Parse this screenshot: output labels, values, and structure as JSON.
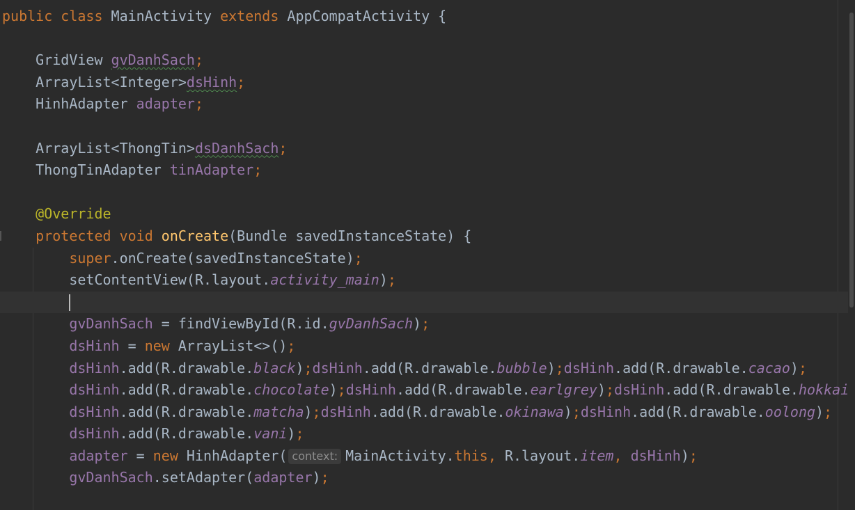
{
  "editor": {
    "current_line_index": 13,
    "lines": [
      {
        "tokens": [
          {
            "t": "public ",
            "c": "keyword"
          },
          {
            "t": "class ",
            "c": "keyword"
          },
          {
            "t": "MainActivity ",
            "c": "ident"
          },
          {
            "t": "extends ",
            "c": "keyword"
          },
          {
            "t": "AppCompatActivity {",
            "c": "ident"
          }
        ]
      },
      {
        "tokens": []
      },
      {
        "tokens": [
          {
            "t": "    GridView ",
            "c": "ident"
          },
          {
            "t": "gvDanhSach",
            "c": "field",
            "warn": true
          },
          {
            "t": ";",
            "c": "punct"
          }
        ]
      },
      {
        "tokens": [
          {
            "t": "    ArrayList<Integer>",
            "c": "ident"
          },
          {
            "t": "dsHinh",
            "c": "field",
            "warn": true
          },
          {
            "t": ";",
            "c": "punct"
          }
        ]
      },
      {
        "tokens": [
          {
            "t": "    HinhAdapter ",
            "c": "ident"
          },
          {
            "t": "adapter",
            "c": "field"
          },
          {
            "t": ";",
            "c": "punct"
          }
        ]
      },
      {
        "tokens": []
      },
      {
        "tokens": [
          {
            "t": "    ArrayList<ThongTin>",
            "c": "ident"
          },
          {
            "t": "dsDanhSach",
            "c": "field",
            "warn": true
          },
          {
            "t": ";",
            "c": "punct"
          }
        ]
      },
      {
        "tokens": [
          {
            "t": "    ThongTinAdapter ",
            "c": "ident"
          },
          {
            "t": "tinAdapter",
            "c": "field"
          },
          {
            "t": ";",
            "c": "punct"
          }
        ]
      },
      {
        "tokens": []
      },
      {
        "tokens": [
          {
            "t": "    @Override",
            "c": "annotation"
          }
        ]
      },
      {
        "tokens": [
          {
            "t": "    protected ",
            "c": "keyword"
          },
          {
            "t": "void ",
            "c": "keyword"
          },
          {
            "t": "onCreate",
            "c": "method"
          },
          {
            "t": "(Bundle savedInstanceState) {",
            "c": "ident"
          }
        ]
      },
      {
        "tokens": [
          {
            "t": "        super",
            "c": "keyword"
          },
          {
            "t": ".onCreate(savedInstanceState)",
            "c": "ident"
          },
          {
            "t": ";",
            "c": "punct"
          }
        ]
      },
      {
        "tokens": [
          {
            "t": "        setContentView(R.layout.",
            "c": "ident"
          },
          {
            "t": "activity_main",
            "c": "static"
          },
          {
            "t": ")",
            "c": "ident"
          },
          {
            "t": ";",
            "c": "punct"
          }
        ]
      },
      {
        "tokens": [
          {
            "t": "        ",
            "c": "ident"
          },
          {
            "caret": true
          }
        ]
      },
      {
        "tokens": [
          {
            "t": "        ",
            "c": "ident"
          },
          {
            "t": "gvDanhSach",
            "c": "field"
          },
          {
            "t": " = findViewById(R.id.",
            "c": "ident"
          },
          {
            "t": "gvDanhSach",
            "c": "static"
          },
          {
            "t": ")",
            "c": "ident"
          },
          {
            "t": ";",
            "c": "punct"
          }
        ]
      },
      {
        "tokens": [
          {
            "t": "        ",
            "c": "ident"
          },
          {
            "t": "dsHinh",
            "c": "field"
          },
          {
            "t": " = ",
            "c": "ident"
          },
          {
            "t": "new ",
            "c": "keyword"
          },
          {
            "t": "ArrayList<>()",
            "c": "ident"
          },
          {
            "t": ";",
            "c": "punct"
          }
        ]
      },
      {
        "tokens": [
          {
            "t": "        ",
            "c": "ident"
          },
          {
            "t": "dsHinh",
            "c": "field"
          },
          {
            "t": ".add(R.drawable.",
            "c": "ident"
          },
          {
            "t": "black",
            "c": "static"
          },
          {
            "t": ")",
            "c": "ident"
          },
          {
            "t": ";",
            "c": "punct"
          },
          {
            "t": "dsHinh",
            "c": "field"
          },
          {
            "t": ".add(R.drawable.",
            "c": "ident"
          },
          {
            "t": "bubble",
            "c": "static"
          },
          {
            "t": ")",
            "c": "ident"
          },
          {
            "t": ";",
            "c": "punct"
          },
          {
            "t": "dsHinh",
            "c": "field"
          },
          {
            "t": ".add(R.drawable.",
            "c": "ident"
          },
          {
            "t": "cacao",
            "c": "static"
          },
          {
            "t": ")",
            "c": "ident"
          },
          {
            "t": ";",
            "c": "punct"
          }
        ]
      },
      {
        "tokens": [
          {
            "t": "        ",
            "c": "ident"
          },
          {
            "t": "dsHinh",
            "c": "field"
          },
          {
            "t": ".add(R.drawable.",
            "c": "ident"
          },
          {
            "t": "chocolate",
            "c": "static"
          },
          {
            "t": ")",
            "c": "ident"
          },
          {
            "t": ";",
            "c": "punct"
          },
          {
            "t": "dsHinh",
            "c": "field"
          },
          {
            "t": ".add(R.drawable.",
            "c": "ident"
          },
          {
            "t": "earlgrey",
            "c": "static"
          },
          {
            "t": ")",
            "c": "ident"
          },
          {
            "t": ";",
            "c": "punct"
          },
          {
            "t": "dsHinh",
            "c": "field"
          },
          {
            "t": ".add(R.drawable.",
            "c": "ident"
          },
          {
            "t": "hokkaido",
            "c": "static"
          }
        ]
      },
      {
        "tokens": [
          {
            "t": "        ",
            "c": "ident"
          },
          {
            "t": "dsHinh",
            "c": "field"
          },
          {
            "t": ".add(R.drawable.",
            "c": "ident"
          },
          {
            "t": "matcha",
            "c": "static"
          },
          {
            "t": ")",
            "c": "ident"
          },
          {
            "t": ";",
            "c": "punct"
          },
          {
            "t": "dsHinh",
            "c": "field"
          },
          {
            "t": ".add(R.drawable.",
            "c": "ident"
          },
          {
            "t": "okinawa",
            "c": "static"
          },
          {
            "t": ")",
            "c": "ident"
          },
          {
            "t": ";",
            "c": "punct"
          },
          {
            "t": "dsHinh",
            "c": "field"
          },
          {
            "t": ".add(R.drawable.",
            "c": "ident"
          },
          {
            "t": "oolong",
            "c": "static"
          },
          {
            "t": ")",
            "c": "ident"
          },
          {
            "t": ";",
            "c": "punct"
          }
        ]
      },
      {
        "tokens": [
          {
            "t": "        ",
            "c": "ident"
          },
          {
            "t": "dsHinh",
            "c": "field"
          },
          {
            "t": ".add(R.drawable.",
            "c": "ident"
          },
          {
            "t": "vani",
            "c": "static"
          },
          {
            "t": ")",
            "c": "ident"
          },
          {
            "t": ";",
            "c": "punct"
          }
        ]
      },
      {
        "tokens": [
          {
            "t": "        ",
            "c": "ident"
          },
          {
            "t": "adapter",
            "c": "field"
          },
          {
            "t": " = ",
            "c": "ident"
          },
          {
            "t": "new ",
            "c": "keyword"
          },
          {
            "t": "HinhAdapter(",
            "c": "ident"
          },
          {
            "hint": "context:"
          },
          {
            "t": "MainActivity.",
            "c": "ident"
          },
          {
            "t": "this",
            "c": "keyword"
          },
          {
            "t": ", ",
            "c": "punct"
          },
          {
            "t": "R.layout.",
            "c": "ident"
          },
          {
            "t": "item",
            "c": "static"
          },
          {
            "t": ", ",
            "c": "punct"
          },
          {
            "t": "dsHinh",
            "c": "field"
          },
          {
            "t": ")",
            "c": "ident"
          },
          {
            "t": ";",
            "c": "punct"
          }
        ]
      },
      {
        "tokens": [
          {
            "t": "        ",
            "c": "ident"
          },
          {
            "t": "gvDanhSach",
            "c": "field"
          },
          {
            "t": ".setAdapter(",
            "c": "ident"
          },
          {
            "t": "adapter",
            "c": "field"
          },
          {
            "t": ")",
            "c": "ident"
          },
          {
            "t": ";",
            "c": "punct"
          }
        ]
      },
      {
        "tokens": []
      }
    ]
  }
}
